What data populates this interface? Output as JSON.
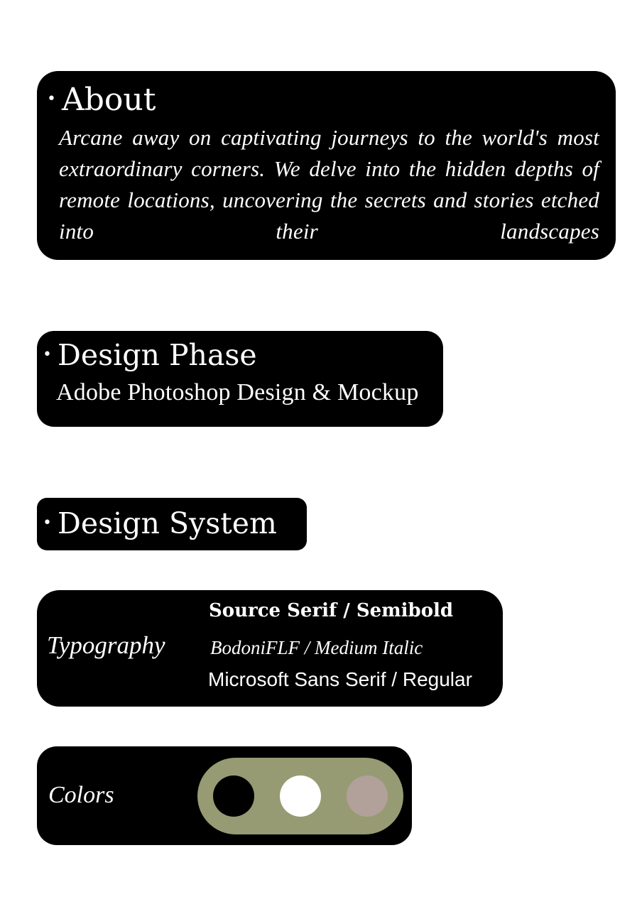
{
  "sections": {
    "about": {
      "bullet": "•",
      "title": "About",
      "text": "Arcane away on captivating journeys to the world's most extraordinary corners. We delve into the hidden depths of remote locations, uncovering the secrets and stories etched into their landscapes"
    },
    "design_phase": {
      "bullet": "•",
      "title": "Design Phase",
      "text": "Adobe Photoshop Design & Mockup"
    },
    "design_system": {
      "bullet": "•",
      "title": "Design System"
    },
    "typography": {
      "label": "Typography",
      "fonts": [
        "Source Serif / Semibold",
        "BodoniFLF / Medium Italic",
        "Microsoft Sans Serif / Regular"
      ]
    },
    "colors": {
      "label": "Colors",
      "pill_color": "#979b73",
      "swatches": [
        "#000000",
        "#ffffff",
        "#b1a19a"
      ]
    }
  }
}
